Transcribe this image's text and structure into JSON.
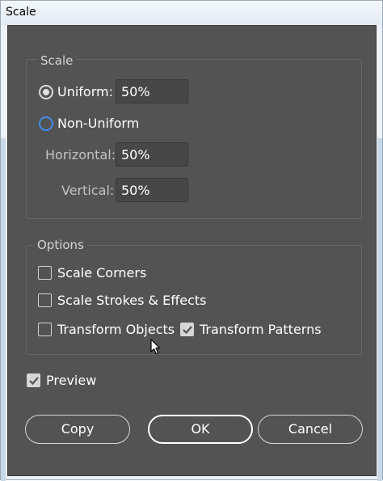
{
  "window": {
    "title": "Scale"
  },
  "scale_group": {
    "label": "Scale",
    "uniform": {
      "label": "Uniform:",
      "value": "50%",
      "selected": true
    },
    "non_uniform": {
      "label": "Non-Uniform",
      "selected": false
    },
    "horizontal": {
      "label": "Horizontal:",
      "value": "50%"
    },
    "vertical": {
      "label": "Vertical:",
      "value": "50%"
    }
  },
  "options_group": {
    "label": "Options",
    "scale_corners": {
      "label": "Scale Corners",
      "checked": false
    },
    "scale_strokes": {
      "label": "Scale Strokes & Effects",
      "checked": false
    },
    "transform_objects": {
      "label": "Transform Objects",
      "checked": false
    },
    "transform_patterns": {
      "label": "Transform Patterns",
      "checked": true
    }
  },
  "preview": {
    "label": "Preview",
    "checked": true
  },
  "buttons": {
    "copy": "Copy",
    "ok": "OK",
    "cancel": "Cancel"
  },
  "colors": {
    "dialog_bg": "#535353",
    "field_bg": "#474747",
    "radio_accent": "#3f8ee8",
    "text": "#ffffff"
  }
}
